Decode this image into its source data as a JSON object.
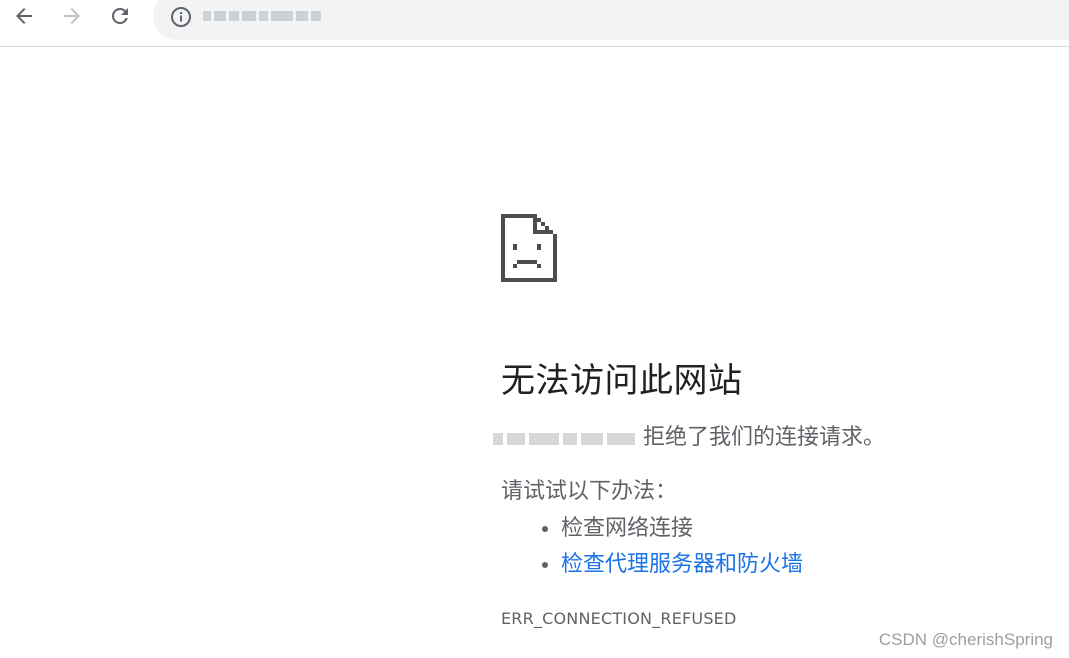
{
  "error": {
    "title": "无法访问此网站",
    "host_message": "拒绝了我们的连接请求。",
    "suggestions_title": "请试试以下办法：",
    "suggestions": [
      {
        "label": "检查网络连接",
        "link": false
      },
      {
        "label": "检查代理服务器和防火墙",
        "link": true
      }
    ],
    "code": "ERR_CONNECTION_REFUSED"
  },
  "watermark": "CSDN @cherishSpring",
  "icons": {
    "back": "back-arrow-icon",
    "forward": "forward-arrow-icon",
    "reload": "reload-icon",
    "info": "info-icon",
    "sad_page": "sad-page-icon"
  },
  "colors": {
    "link": "#1a73e8",
    "text": "#202124",
    "secondary_text": "#5f6368",
    "omnibox": "#f1f3f4"
  }
}
